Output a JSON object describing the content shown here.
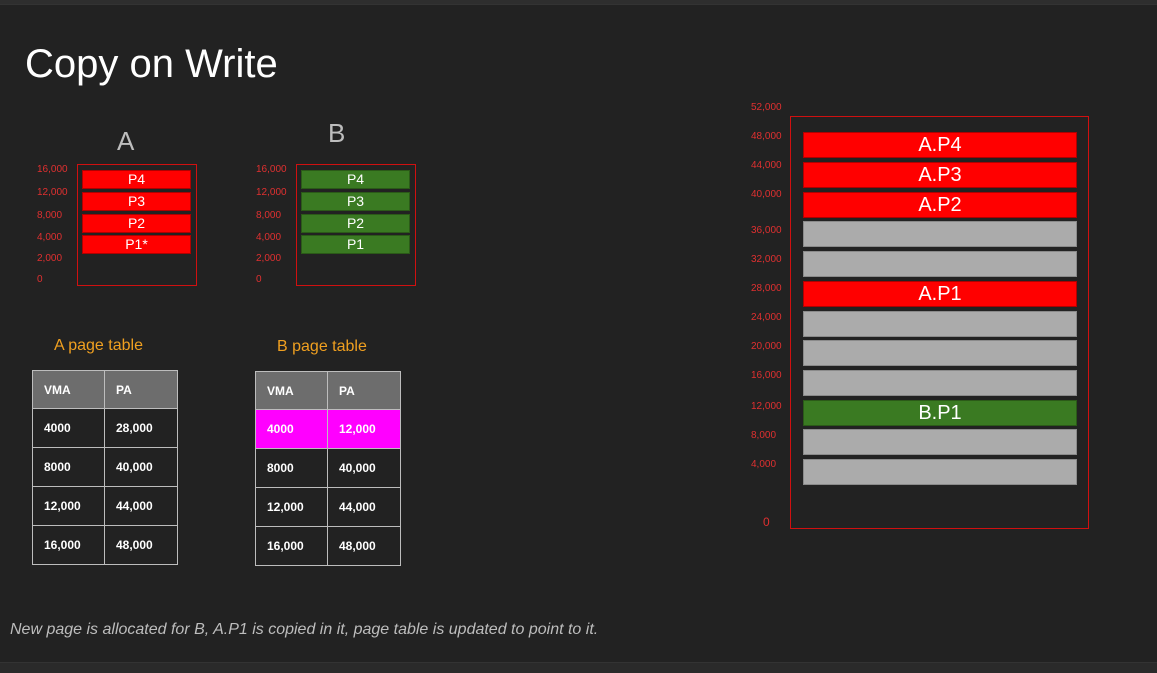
{
  "title": "Copy on Write",
  "caption": "New page is allocated for B, A.P1 is copied in it, page table is updated to point to it.",
  "colors": {
    "red": "#ff0000",
    "green": "#3a7a22",
    "gray": "#ababab",
    "magenta": "#ff00ff",
    "axis": "#e03030",
    "label": "#f0a020"
  },
  "processA": {
    "heading": "A",
    "y_labels": [
      "16,000",
      "12,000",
      "8,000",
      "4,000",
      "2,000",
      "0"
    ],
    "pages": [
      "P4",
      "P3",
      "P2",
      "P1*"
    ]
  },
  "processB": {
    "heading": "B",
    "y_labels": [
      "16,000",
      "12,000",
      "8,000",
      "4,000",
      "2,000",
      "0"
    ],
    "pages": [
      "P4",
      "P3",
      "P2",
      "P1"
    ]
  },
  "tableA": {
    "label": "A page table",
    "headers": [
      "VMA",
      "PA"
    ],
    "rows": [
      [
        "4000",
        "28,000"
      ],
      [
        "8000",
        "40,000"
      ],
      [
        "12,000",
        "44,000"
      ],
      [
        "16,000",
        "48,000"
      ]
    ]
  },
  "tableB": {
    "label": "B page table",
    "headers": [
      "VMA",
      "PA"
    ],
    "rows": [
      [
        "4000",
        "12,000"
      ],
      [
        "8000",
        "40,000"
      ],
      [
        "12,000",
        "44,000"
      ],
      [
        "16,000",
        "48,000"
      ]
    ]
  },
  "physical": {
    "y_labels": [
      "52,000",
      "48,000",
      "44,000",
      "40,000",
      "36,000",
      "32,000",
      "28,000",
      "24,000",
      "20,000",
      "16,000",
      "12,000",
      "8,000",
      "4,000",
      "0"
    ],
    "frames": [
      {
        "label": "A.P4",
        "color": "red"
      },
      {
        "label": "A.P3",
        "color": "red"
      },
      {
        "label": "A.P2",
        "color": "red"
      },
      {
        "label": "",
        "color": "gray"
      },
      {
        "label": "",
        "color": "gray"
      },
      {
        "label": "A.P1",
        "color": "red"
      },
      {
        "label": "",
        "color": "gray"
      },
      {
        "label": "",
        "color": "gray"
      },
      {
        "label": "",
        "color": "gray"
      },
      {
        "label": "B.P1",
        "color": "green"
      },
      {
        "label": "",
        "color": "gray"
      },
      {
        "label": "",
        "color": "gray"
      }
    ]
  }
}
